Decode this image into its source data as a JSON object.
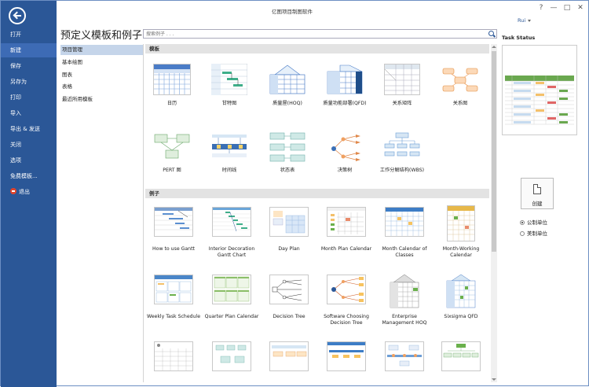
{
  "app": {
    "title": "亿图项目制图软件",
    "user": "Rui"
  },
  "window_controls": {
    "help": "?",
    "minimize": "—",
    "maximize": "□",
    "close": "✕"
  },
  "nav": {
    "items": [
      {
        "label": "打开"
      },
      {
        "label": "新建"
      },
      {
        "label": "保存"
      },
      {
        "label": "另存为"
      },
      {
        "label": "打印"
      },
      {
        "label": "导入"
      },
      {
        "label": "导出 & 发送"
      },
      {
        "label": "关闭"
      },
      {
        "label": "选项"
      },
      {
        "label": "免费模板..."
      },
      {
        "label": "退出"
      }
    ],
    "active": "新建"
  },
  "main": {
    "heading": "预定义模板和例子",
    "search_placeholder": "搜索例子 . . .",
    "categories": [
      {
        "label": "项目管理"
      },
      {
        "label": "基本绘图"
      },
      {
        "label": "图表"
      },
      {
        "label": "表格"
      },
      {
        "label": "最近所用模板"
      }
    ],
    "templates_header": "模板",
    "templates": [
      {
        "label": "日历",
        "icon": "calendar-thumb"
      },
      {
        "label": "甘特图",
        "icon": "gantt-thumb"
      },
      {
        "label": "质量屋(HOQ)",
        "icon": "hoq-thumb"
      },
      {
        "label": "质量功能部署(QFD)",
        "icon": "qfd-thumb"
      },
      {
        "label": "关系矩阵",
        "icon": "matrix-thumb"
      },
      {
        "label": "关系图",
        "icon": "relation-thumb"
      },
      {
        "label": "PERT 图",
        "icon": "pert-thumb"
      },
      {
        "label": "时间线",
        "icon": "timeline-thumb"
      },
      {
        "label": "状态表",
        "icon": "status-thumb"
      },
      {
        "label": "决策树",
        "icon": "decision-thumb"
      },
      {
        "label": "工作分解结构(WBS)",
        "icon": "wbs-thumb"
      }
    ],
    "examples_header": "例子",
    "examples": [
      {
        "label": "How to use Gantt"
      },
      {
        "label": "Interior Decoration Gantt Chart"
      },
      {
        "label": "Day Plan"
      },
      {
        "label": "Month Plan Calendar"
      },
      {
        "label": "Month Calendar of Classes"
      },
      {
        "label": "Month-Working Calendar"
      },
      {
        "label": "Weekly Task Schedule"
      },
      {
        "label": "Quarter Plan Calendar"
      },
      {
        "label": "Decision Tree"
      },
      {
        "label": "Software Choosing Decision Tree"
      },
      {
        "label": "Enterprise Management HOQ"
      },
      {
        "label": "Sixsigma QFD"
      },
      {
        "label": ""
      },
      {
        "label": ""
      },
      {
        "label": ""
      },
      {
        "label": ""
      },
      {
        "label": ""
      },
      {
        "label": ""
      }
    ]
  },
  "right_panel": {
    "title": "Task Status",
    "create_label": "创建",
    "units": [
      {
        "label": "公制单位",
        "selected": true
      },
      {
        "label": "美制单位",
        "selected": false
      }
    ]
  },
  "colors": {
    "nav_bg": "#2b5797",
    "nav_active": "#3d6bb5",
    "category_active": "#c5d5ea",
    "accent_blue": "#4a7cc7",
    "accent_orange": "#f0a060"
  }
}
